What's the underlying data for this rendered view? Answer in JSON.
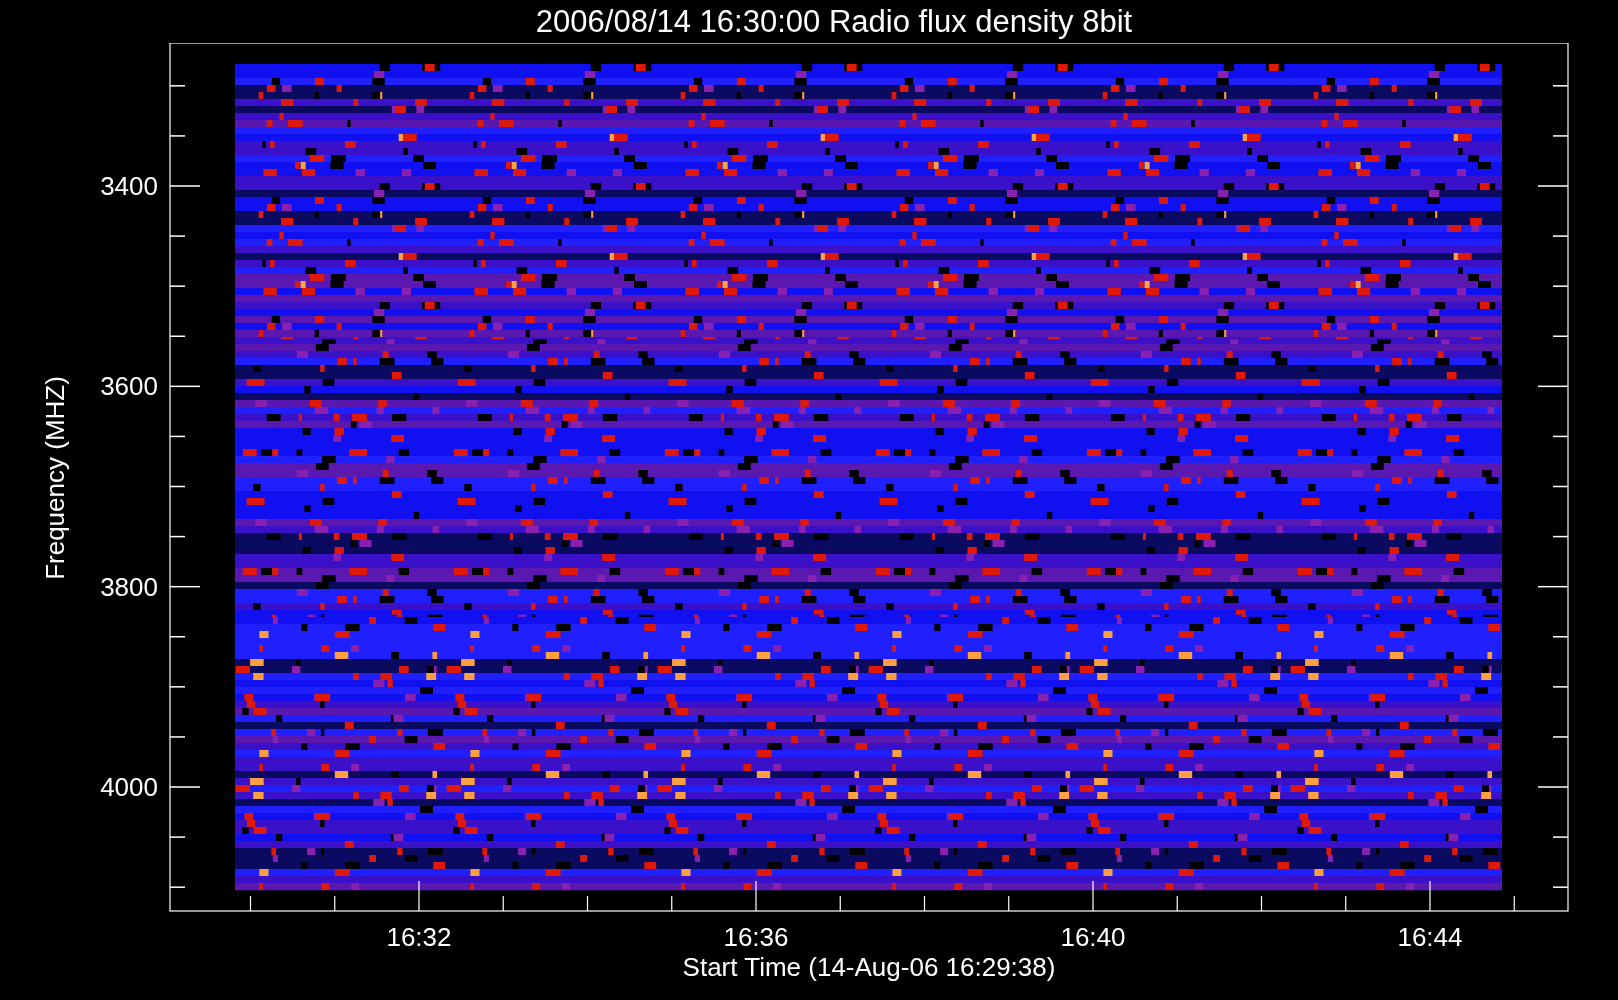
{
  "title": "2006/08/14 16:30:00 Radio flux density 8bit",
  "y_axis": {
    "label": "Frequency (MHZ)",
    "ticks": [
      "3400",
      "3600",
      "3800",
      "4000"
    ]
  },
  "x_axis": {
    "label": "Start Time (14-Aug-06 16:29:38)",
    "ticks": [
      "16:32",
      "16:36",
      "16:40",
      "16:44"
    ]
  }
}
